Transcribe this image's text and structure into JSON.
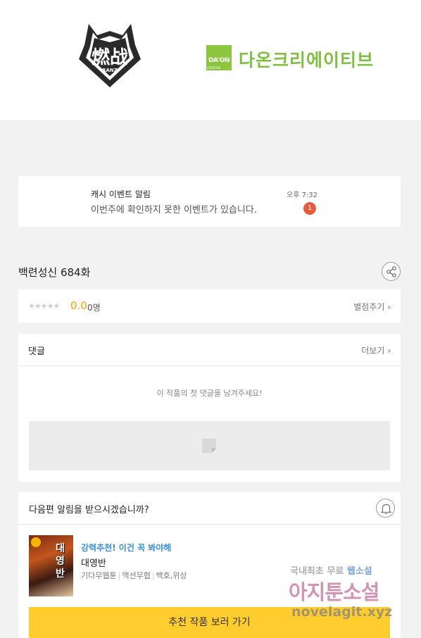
{
  "banner": {
    "left_logo_text": "燃战",
    "left_logo_sub": "RANZ",
    "right_logo_mark": "DA'ON",
    "right_logo_mark_sub": "CREATIVE",
    "right_logo_text": "다온크리에이티브"
  },
  "notice": {
    "title": "캐시 이벤트 알림",
    "text": "이번주에 확인하지 못한 이벤트가 있습니다.",
    "time": "오후 7:32",
    "badge": "1"
  },
  "episode": {
    "title": "백련성신 684화",
    "share_icon": "share-icon"
  },
  "rating": {
    "stars": "★★★★★",
    "score": "0.0",
    "count": "0명",
    "rate_link": "별점주기 ›"
  },
  "comments": {
    "title": "댓글",
    "more_link": "더보기 ›",
    "empty_text": "이 작품의 첫 댓글을 남겨주세요!"
  },
  "next_episode": {
    "question": "다음편 알림을 받으시겠습니까?",
    "bell_icon": "bell-icon"
  },
  "recommendation": {
    "tag": "강력추천! 이건 꼭 봐야해",
    "title": "대영반",
    "meta": [
      "기다무웹툰",
      "액션무협",
      "백호,위상"
    ],
    "thumbnail_title": "대영반",
    "button": "추천 작품 보러 가기"
  },
  "watermark": {
    "line1_a": "국내최초 무료 ",
    "line1_b": "웹소설",
    "line2": "아지툰소설",
    "line3": "novelagit.xyz"
  },
  "colors": {
    "accent_yellow": "#ffcd2e",
    "score_orange": "#f2a100",
    "badge_red": "#e85a3c",
    "link_blue": "#3a8fd8",
    "brand_green": "#8cc63f"
  }
}
